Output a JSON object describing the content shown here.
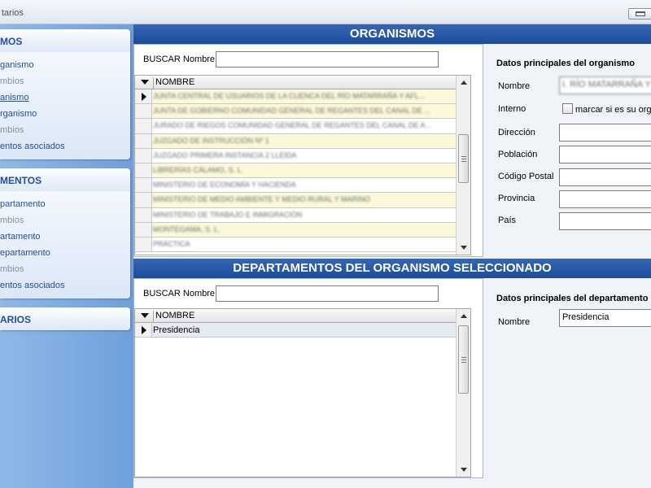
{
  "window": {
    "title": "tarios"
  },
  "sidebar": {
    "groups": [
      {
        "header": "MOS",
        "items": [
          {
            "label": "ganismo",
            "state": "active"
          },
          {
            "label": "mbios",
            "state": "disabled"
          },
          {
            "label": "anismo",
            "state": "selected"
          },
          {
            "label": "rganismo",
            "state": "active"
          },
          {
            "label": "mbios",
            "state": "disabled"
          },
          {
            "label": "entos asociados",
            "state": "active"
          }
        ]
      },
      {
        "header": "MENTOS",
        "items": [
          {
            "label": "partamento",
            "state": "active"
          },
          {
            "label": "mbios",
            "state": "disabled"
          },
          {
            "label": "artamento",
            "state": "active"
          },
          {
            "label": "epartamento",
            "state": "active"
          },
          {
            "label": "mbios",
            "state": "disabled"
          },
          {
            "label": "entos asociados",
            "state": "active"
          }
        ]
      },
      {
        "header": "ARIOS",
        "items": []
      }
    ]
  },
  "organismos": {
    "title": "ORGANISMOS",
    "search_label": "BUSCAR Nombre",
    "search_value": "",
    "column": "NOMBRE",
    "rows": [
      {
        "text": "JUNTA CENTRAL DE USUARIOS DE LA CUENCA DEL RÍO MATARRAÑA Y AFL...",
        "tone": "yellow",
        "current": true
      },
      {
        "text": "JUNTA DE GOBIERNO COMUNIDAD GENERAL DE REGANTES DEL CANAL DE ...",
        "tone": "yellow",
        "current": false
      },
      {
        "text": "JURADO DE RIEGOS COMUNIDAD GENERAL DE REGANTES DEL CANAL DE A...",
        "tone": "white",
        "current": false
      },
      {
        "text": "JUZGADO DE INSTRUCCIÓN Nº 1",
        "tone": "yellow",
        "current": false
      },
      {
        "text": "JUZGADO PRIMERA INSTANCIA 2 LLEIDA",
        "tone": "white",
        "current": false
      },
      {
        "text": "LIBRERÍAS CÁLAMO, S. L.",
        "tone": "yellow",
        "current": false
      },
      {
        "text": "MINISTERIO DE ECONOMÍA Y HACIENDA",
        "tone": "white",
        "current": false
      },
      {
        "text": "MINISTERIO DE MEDIO AMBIENTE Y MEDIO RURAL Y MARINO",
        "tone": "yellow",
        "current": false
      },
      {
        "text": "MINISTERIO DE TRABAJO E INMIGRACIÓN",
        "tone": "white",
        "current": false
      },
      {
        "text": "MONTEGAMA, S. L.",
        "tone": "yellow",
        "current": false
      },
      {
        "text": "PRÁCTICA",
        "tone": "white",
        "current": false
      }
    ],
    "details": {
      "heading": "Datos principales del organismo",
      "nombre_label": "Nombre",
      "nombre_value": "I. RÍO MATARRAÑA Y A",
      "interno_label": "Interno",
      "interno_check_label": "marcar si es su organismo",
      "direccion_label": "Dirección",
      "direccion_value": "",
      "poblacion_label": "Población",
      "poblacion_value": "",
      "cp_label": "Código Postal",
      "cp_value": "",
      "provincia_label": "Provincia",
      "provincia_value": "",
      "pais_label": "País",
      "pais_value": ""
    }
  },
  "departamentos": {
    "title": "DEPARTAMENTOS DEL ORGANISMO SELECCIONADO",
    "search_label": "BUSCAR Nombre",
    "search_value": "",
    "column": "NOMBRE",
    "rows": [
      {
        "text": "Presidencia",
        "current": true
      }
    ],
    "details": {
      "heading": "Datos principales del departamento",
      "nombre_label": "Nombre",
      "nombre_value": "Presidencia"
    }
  }
}
